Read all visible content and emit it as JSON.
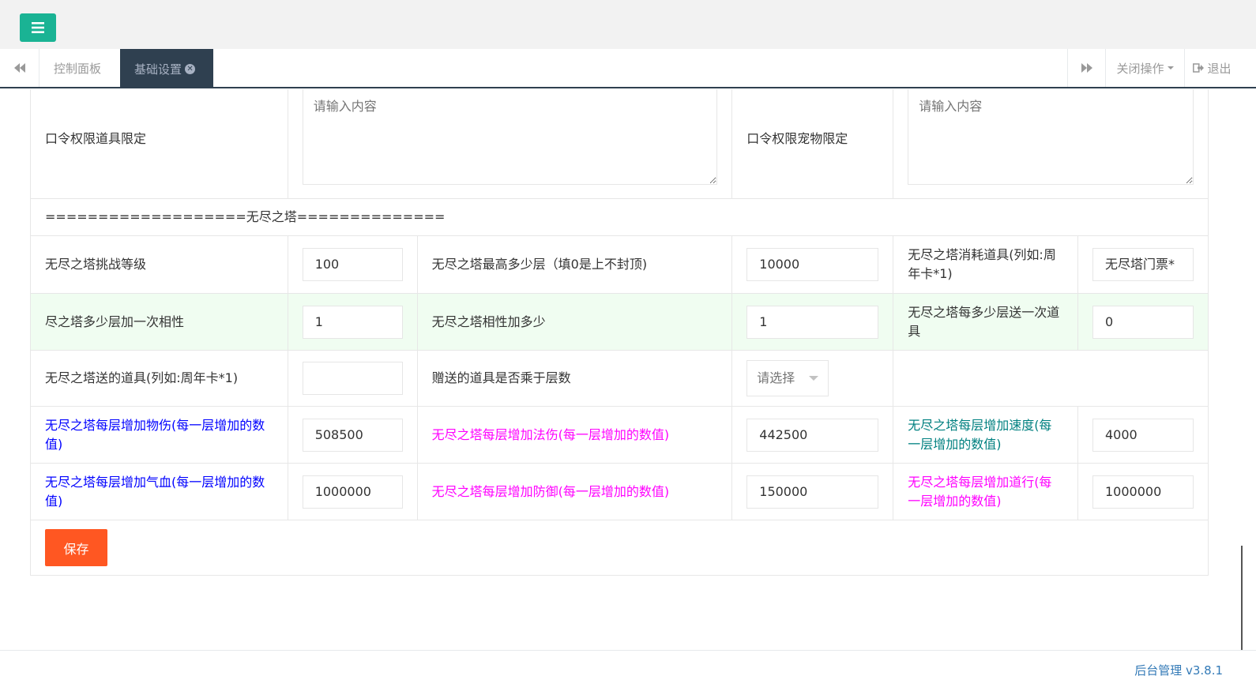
{
  "header": {
    "menu_icon": "menu-icon",
    "accent_color": "#1ab394"
  },
  "tabs": {
    "prev_icon": "double-chevron-left-icon",
    "items": [
      {
        "label": "控制面板",
        "active": false
      },
      {
        "label": "基础设置",
        "active": true
      }
    ],
    "next_icon": "double-chevron-right-icon",
    "close_ops_label": "关闭操作",
    "logout_label": "退出"
  },
  "form": {
    "row_cmd": {
      "item_label": "口令权限道具限定",
      "item_placeholder": "请输入内容",
      "pet_label": "口令权限宠物限定",
      "pet_placeholder": "请输入内容"
    },
    "section_title": "===================无尽之塔==============",
    "rows": [
      {
        "c1": {
          "label": "无尽之塔挑战等级",
          "value": "100"
        },
        "c2": {
          "label": "无尽之塔最高多少层（填0是上不封顶)",
          "value": "10000"
        },
        "c3": {
          "label": "无尽之塔消耗道具(列如:周年卡*1)",
          "value": "无尽塔门票*"
        }
      },
      {
        "c1": {
          "label": "尽之塔多少层加一次相性",
          "value": "1"
        },
        "c2": {
          "label": "无尽之塔相性加多少",
          "value": "1"
        },
        "c3": {
          "label": "无尽之塔每多少层送一次道具",
          "value": "0"
        }
      }
    ],
    "gift_row": {
      "item_label": "无尽之塔送的道具(列如:周年卡*1)",
      "item_value": "",
      "multiply_label": "赠送的道具是否乘于层数",
      "multiply_select": "请选择"
    },
    "stat_rows": [
      {
        "c1": {
          "label": "无尽之塔每层增加物伤(每一层增加的数值)",
          "value": "508500",
          "color": "#0000ff"
        },
        "c2": {
          "label": "无尽之塔每层增加法伤(每一层增加的数值)",
          "value": "442500",
          "color": "#ff00ff"
        },
        "c3": {
          "label": "无尽之塔每层增加速度(每一层增加的数值)",
          "value": "4000",
          "color": "#008080"
        }
      },
      {
        "c1": {
          "label": "无尽之塔每层增加气血(每一层增加的数值)",
          "value": "1000000",
          "color": "#0000ff"
        },
        "c2": {
          "label": "无尽之塔每层增加防御(每一层增加的数值)",
          "value": "150000",
          "color": "#ff00ff"
        },
        "c3": {
          "label": "无尽之塔每层增加道行(每一层增加的数值)",
          "value": "1000000",
          "color": "#ff00ff"
        }
      }
    ],
    "save_label": "保存",
    "save_color": "#ff5722"
  },
  "footer": {
    "text": "后台管理 v3.8.1"
  }
}
